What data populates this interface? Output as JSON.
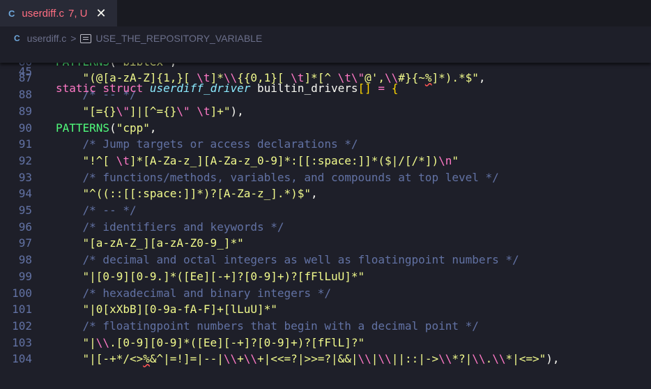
{
  "tab": {
    "icon": "C",
    "filename": "userdiff.c",
    "status": "7, U",
    "close": "✕"
  },
  "breadcrumb": {
    "icon": "C",
    "file": "userdiff.c",
    "separator": ">",
    "symbol": "USE_THE_REPOSITORY_VARIABLE"
  },
  "sticky": {
    "number": "45",
    "tokens": [
      {
        "t": "static",
        "c": "kw"
      },
      {
        "t": " ",
        "c": "plain"
      },
      {
        "t": "struct",
        "c": "kw"
      },
      {
        "t": " ",
        "c": "plain"
      },
      {
        "t": "userdiff_driver",
        "c": "ty"
      },
      {
        "t": " builtin_drivers",
        "c": "plain"
      },
      {
        "t": "[]",
        "c": "br"
      },
      {
        "t": " ",
        "c": "plain"
      },
      {
        "t": "=",
        "c": "op"
      },
      {
        "t": " ",
        "c": "plain"
      },
      {
        "t": "{",
        "c": "br"
      }
    ]
  },
  "lines": [
    {
      "number": "85",
      "tokens": [
        {
          "t": "     \"|\\\\[|\\\\]|\\\\[|\\\\]|\\\\[|\\\\]\"),",
          "c": "str"
        }
      ]
    },
    {
      "number": "86",
      "tokens": [
        {
          "t": "PATTERNS",
          "c": "fn"
        },
        {
          "t": "(",
          "c": "plain"
        },
        {
          "t": "\"bibtex\"",
          "c": "str"
        },
        {
          "t": ",",
          "c": "plain"
        }
      ]
    },
    {
      "number": "87",
      "tokens": [
        {
          "t": "    ",
          "c": "plain"
        },
        {
          "t": "\"(@[a-zA-Z]{1,}[ ",
          "c": "str"
        },
        {
          "t": "\\t",
          "c": "esc"
        },
        {
          "t": "]*",
          "c": "str"
        },
        {
          "t": "\\\\",
          "c": "esc"
        },
        {
          "t": "{{0,1}[ ",
          "c": "str"
        },
        {
          "t": "\\t",
          "c": "esc"
        },
        {
          "t": "]*[^ ",
          "c": "str"
        },
        {
          "t": "\\t\\\"",
          "c": "esc"
        },
        {
          "t": "@',",
          "c": "str"
        },
        {
          "t": "\\\\",
          "c": "esc"
        },
        {
          "t": "#}{~",
          "c": "str"
        },
        {
          "t": "%",
          "c": "str",
          "w": true
        },
        {
          "t": "]*).*$\"",
          "c": "str"
        },
        {
          "t": ",",
          "c": "plain"
        }
      ]
    },
    {
      "number": "88",
      "tokens": [
        {
          "t": "    ",
          "c": "plain"
        },
        {
          "t": "/* -- */",
          "c": "cm"
        }
      ]
    },
    {
      "number": "89",
      "tokens": [
        {
          "t": "    ",
          "c": "plain"
        },
        {
          "t": "\"[={}",
          "c": "str"
        },
        {
          "t": "\\\"",
          "c": "esc"
        },
        {
          "t": "]|[^={}",
          "c": "str"
        },
        {
          "t": "\\\"",
          "c": "esc"
        },
        {
          "t": " ",
          "c": "str"
        },
        {
          "t": "\\t",
          "c": "esc"
        },
        {
          "t": "]+\"",
          "c": "str"
        },
        {
          "t": "),",
          "c": "plain"
        }
      ]
    },
    {
      "number": "90",
      "tokens": [
        {
          "t": "PATTERNS",
          "c": "fn"
        },
        {
          "t": "(",
          "c": "plain"
        },
        {
          "t": "\"cpp\"",
          "c": "str"
        },
        {
          "t": ",",
          "c": "plain"
        }
      ]
    },
    {
      "number": "91",
      "tokens": [
        {
          "t": "    ",
          "c": "plain"
        },
        {
          "t": "/* Jump targets or access declarations */",
          "c": "cm"
        }
      ]
    },
    {
      "number": "92",
      "tokens": [
        {
          "t": "    ",
          "c": "plain"
        },
        {
          "t": "\"!^[ ",
          "c": "str"
        },
        {
          "t": "\\t",
          "c": "esc"
        },
        {
          "t": "]*[A-Za-z_][A-Za-z_0-9]*:[[:space:]]*($|/[/*])",
          "c": "str"
        },
        {
          "t": "\\n",
          "c": "esc"
        },
        {
          "t": "\"",
          "c": "str"
        }
      ]
    },
    {
      "number": "93",
      "tokens": [
        {
          "t": "    ",
          "c": "plain"
        },
        {
          "t": "/* functions/methods, variables, and compounds at top level */",
          "c": "cm"
        }
      ]
    },
    {
      "number": "94",
      "tokens": [
        {
          "t": "    ",
          "c": "plain"
        },
        {
          "t": "\"^((::[[:space:]]*)?[A-Za-z_].*)$\"",
          "c": "str"
        },
        {
          "t": ",",
          "c": "plain"
        }
      ]
    },
    {
      "number": "95",
      "tokens": [
        {
          "t": "    ",
          "c": "plain"
        },
        {
          "t": "/* -- */",
          "c": "cm"
        }
      ]
    },
    {
      "number": "96",
      "tokens": [
        {
          "t": "    ",
          "c": "plain"
        },
        {
          "t": "/* identifiers and keywords */",
          "c": "cm"
        }
      ]
    },
    {
      "number": "97",
      "tokens": [
        {
          "t": "    ",
          "c": "plain"
        },
        {
          "t": "\"[a-zA-Z_][a-zA-Z0-9_]*\"",
          "c": "str"
        }
      ]
    },
    {
      "number": "98",
      "tokens": [
        {
          "t": "    ",
          "c": "plain"
        },
        {
          "t": "/* decimal and octal integers as well as floatingpoint numbers */",
          "c": "cm"
        }
      ]
    },
    {
      "number": "99",
      "tokens": [
        {
          "t": "    ",
          "c": "plain"
        },
        {
          "t": "\"|[0-9][0-9.]*([Ee][-+]?[0-9]+)?[fFlLuU]*\"",
          "c": "str"
        }
      ]
    },
    {
      "number": "100",
      "tokens": [
        {
          "t": "    ",
          "c": "plain"
        },
        {
          "t": "/* hexadecimal and binary integers */",
          "c": "cm"
        }
      ]
    },
    {
      "number": "101",
      "tokens": [
        {
          "t": "    ",
          "c": "plain"
        },
        {
          "t": "\"|0[xXbB][0-9a-fA-F]+[lLuU]*\"",
          "c": "str"
        }
      ]
    },
    {
      "number": "102",
      "tokens": [
        {
          "t": "    ",
          "c": "plain"
        },
        {
          "t": "/* floatingpoint numbers that begin with a decimal point */",
          "c": "cm"
        }
      ]
    },
    {
      "number": "103",
      "tokens": [
        {
          "t": "    ",
          "c": "plain"
        },
        {
          "t": "\"|",
          "c": "str"
        },
        {
          "t": "\\\\",
          "c": "esc"
        },
        {
          "t": ".[0-9][0-9]*([Ee][-+]?[0-9]+)?[fFlL]?\"",
          "c": "str"
        }
      ]
    },
    {
      "number": "104",
      "tokens": [
        {
          "t": "    ",
          "c": "plain"
        },
        {
          "t": "\"|[-+*/<>",
          "c": "str"
        },
        {
          "t": "%",
          "c": "str",
          "w": true
        },
        {
          "t": "&^|=!]=|--|",
          "c": "str"
        },
        {
          "t": "\\\\",
          "c": "esc"
        },
        {
          "t": "+",
          "c": "str"
        },
        {
          "t": "\\\\",
          "c": "esc"
        },
        {
          "t": "+|<<=?|>>=?|&&|",
          "c": "str"
        },
        {
          "t": "\\\\",
          "c": "esc"
        },
        {
          "t": "|",
          "c": "str"
        },
        {
          "t": "\\\\",
          "c": "esc"
        },
        {
          "t": "||::|->",
          "c": "str"
        },
        {
          "t": "\\\\",
          "c": "esc"
        },
        {
          "t": "*?|",
          "c": "str"
        },
        {
          "t": "\\\\",
          "c": "esc"
        },
        {
          "t": ".",
          "c": "str"
        },
        {
          "t": "\\\\",
          "c": "esc"
        },
        {
          "t": "*|<=>\"",
          "c": "str"
        },
        {
          "t": "),",
          "c": "plain"
        }
      ]
    }
  ]
}
